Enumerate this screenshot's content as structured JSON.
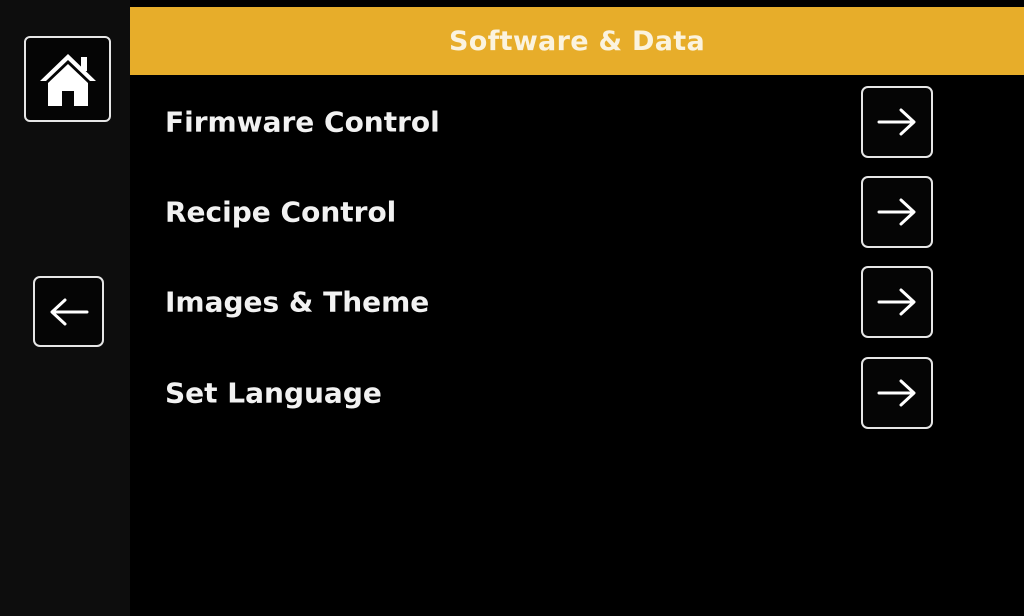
{
  "header": {
    "title": "Software & Data",
    "color": "#e7ad2a"
  },
  "sidebar": {
    "home_icon": "home-icon",
    "back_icon": "arrow-left-icon"
  },
  "menu": {
    "items": [
      {
        "label": "Firmware Control",
        "icon": "arrow-right-icon"
      },
      {
        "label": "Recipe Control",
        "icon": "arrow-right-icon"
      },
      {
        "label": "Images & Theme",
        "icon": "arrow-right-icon"
      },
      {
        "label": "Set Language",
        "icon": "arrow-right-icon"
      }
    ]
  }
}
